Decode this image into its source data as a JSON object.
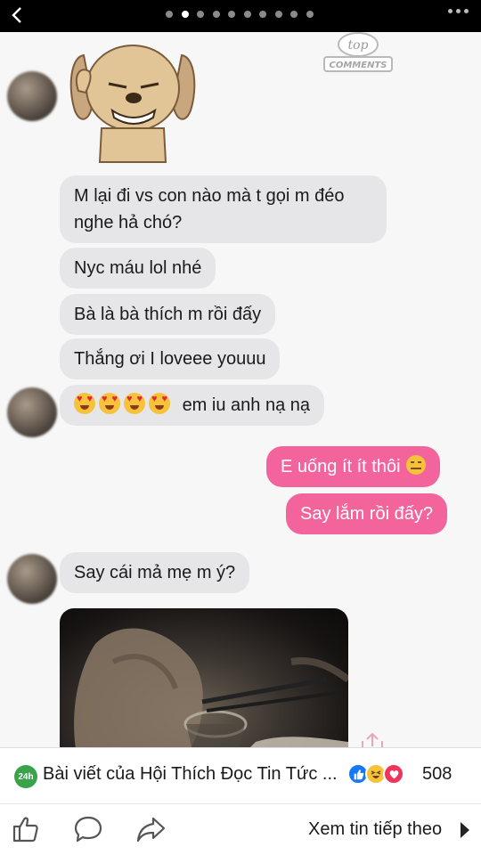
{
  "viewer": {
    "total_pages": 10,
    "active_page": 2
  },
  "watermark": {
    "line1": "top",
    "line2": "COMMENTS"
  },
  "messages": [
    {
      "sender": "them",
      "text": "M lại đi vs con nào mà t gọi m đéo nghe hả chó?"
    },
    {
      "sender": "them",
      "text": "Nyc máu lol nhé"
    },
    {
      "sender": "them",
      "text": "Bà là bà thích m rồi đấy"
    },
    {
      "sender": "them",
      "text": "Thắng ơi I loveee youuu"
    },
    {
      "sender": "them",
      "text": "em iu anh nạ nạ",
      "emoji_prefix": "heart-eyes-icon x4"
    },
    {
      "sender": "me",
      "text": "E uống ít ít thôi",
      "emoji_suffix": "neutral-face-icon"
    },
    {
      "sender": "me",
      "text": "Say lắm rồi đấy?"
    },
    {
      "sender": "them",
      "text": "Say cái mả mẹ m ý?"
    }
  ],
  "footer": {
    "source_icon_text": "24h",
    "source_text": "Bài viết của Hội Thích Đọc Tin Tức ...",
    "reaction_count": "508",
    "next_label": "Xem tin tiếp theo"
  },
  "colors": {
    "my_bubble": "#f2649b",
    "their_bubble": "#e6e6e9",
    "like_blue": "#1877f2"
  }
}
